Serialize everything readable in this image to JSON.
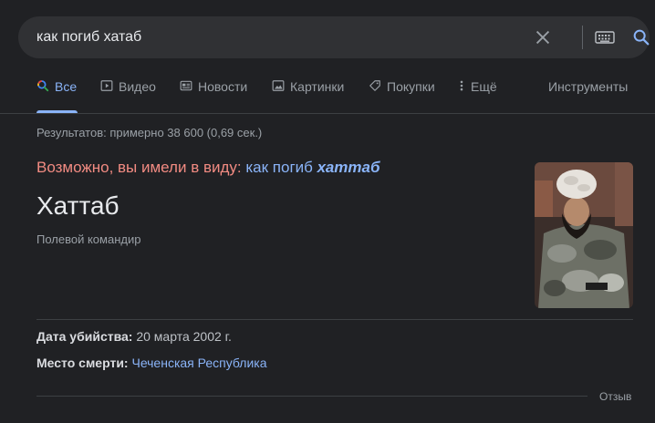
{
  "search": {
    "query": "как погиб хатаб"
  },
  "tabs": [
    {
      "label": "Все",
      "icon": "search-icon",
      "active": true
    },
    {
      "label": "Видео",
      "icon": "play-icon"
    },
    {
      "label": "Новости",
      "icon": "news-icon"
    },
    {
      "label": "Картинки",
      "icon": "image-icon"
    },
    {
      "label": "Покупки",
      "icon": "tag-icon"
    },
    {
      "label": "Ещё",
      "icon": "more-vert-icon"
    }
  ],
  "tools_label": "Инструменты",
  "results_stats": "Результатов: примерно 38 600 (0,69 сек.)",
  "did_you_mean": {
    "prefix": "Возможно, вы имели в виду:",
    "link_normal": "как погиб",
    "link_bold": "хаттаб"
  },
  "entity": {
    "title": "Хаттаб",
    "subtitle": "Полевой командир"
  },
  "facts": [
    {
      "label": "Дата убийства:",
      "value": "20 марта 2002 г."
    },
    {
      "label": "Место смерти:",
      "value": "Чеченская Республика"
    }
  ],
  "feedback_label": "Отзыв",
  "colors": {
    "background": "#202124",
    "link": "#8ab4f8",
    "did_you_mean_red": "#f28b82"
  }
}
